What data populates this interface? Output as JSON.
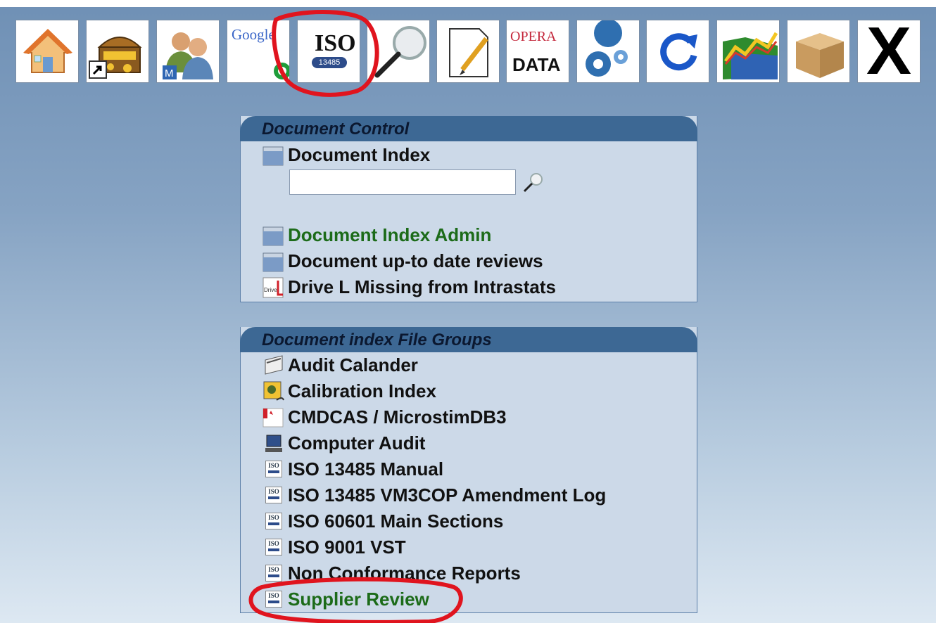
{
  "toolbar": {
    "buttons": [
      {
        "id": "home",
        "icon": "house-icon"
      },
      {
        "id": "treasure",
        "icon": "treasure-chest-shortcut-icon"
      },
      {
        "id": "users",
        "icon": "users-icon"
      },
      {
        "id": "google",
        "icon": "google-icon",
        "text": "Google"
      },
      {
        "id": "iso",
        "icon": "iso-13485-icon",
        "text": "ISO",
        "subtext": "13485"
      },
      {
        "id": "search",
        "icon": "magnifier-icon"
      },
      {
        "id": "notepad",
        "icon": "notepad-pencil-icon"
      },
      {
        "id": "opera",
        "icon": "opera-data-icon",
        "text": "OPERA",
        "subtext": "DATA"
      },
      {
        "id": "settings",
        "icon": "gears-icon"
      },
      {
        "id": "refresh",
        "icon": "refresh-icon"
      },
      {
        "id": "chart",
        "icon": "chart-folder-icon"
      },
      {
        "id": "box",
        "icon": "box-icon"
      },
      {
        "id": "close",
        "icon": "close-x-icon",
        "text": "X"
      }
    ]
  },
  "document_control": {
    "title": "Document Control",
    "items": [
      {
        "label": "Document Index",
        "icon": "folder-icon"
      },
      {
        "label": "Document Index Admin",
        "icon": "folder-icon"
      },
      {
        "label": "Document up-to date reviews",
        "icon": "folder-icon"
      },
      {
        "label": "Drive L Missing from Intrastats",
        "icon": "drive-l-icon"
      }
    ],
    "search": {
      "value": "",
      "placeholder": ""
    }
  },
  "file_groups": {
    "title": "Document index File Groups",
    "items": [
      {
        "label": "Audit Calander",
        "icon": "calendar-icon"
      },
      {
        "label": "Calibration Index",
        "icon": "calibration-icon"
      },
      {
        "label": "CMDCAS / MicrostimDB3",
        "icon": "canada-flag-icon"
      },
      {
        "label": "Computer Audit",
        "icon": "computer-icon"
      },
      {
        "label": "ISO 13485 Manual",
        "icon": "iso-icon"
      },
      {
        "label": "ISO 13485 VM3COP Amendment Log",
        "icon": "iso-icon"
      },
      {
        "label": "ISO 60601 Main Sections",
        "icon": "iso-icon"
      },
      {
        "label": "ISO 9001 VST",
        "icon": "iso-icon"
      },
      {
        "label": "Non Conformance Reports",
        "icon": "iso-icon"
      },
      {
        "label": "Supplier Review",
        "icon": "iso-icon"
      }
    ]
  },
  "iso_mini": {
    "text": "ISO"
  },
  "colors": {
    "panel_header": "#3d6894",
    "panel_body": "#ccd9e8",
    "link_green": "#1c6b19",
    "annotation": "#e0141e"
  }
}
